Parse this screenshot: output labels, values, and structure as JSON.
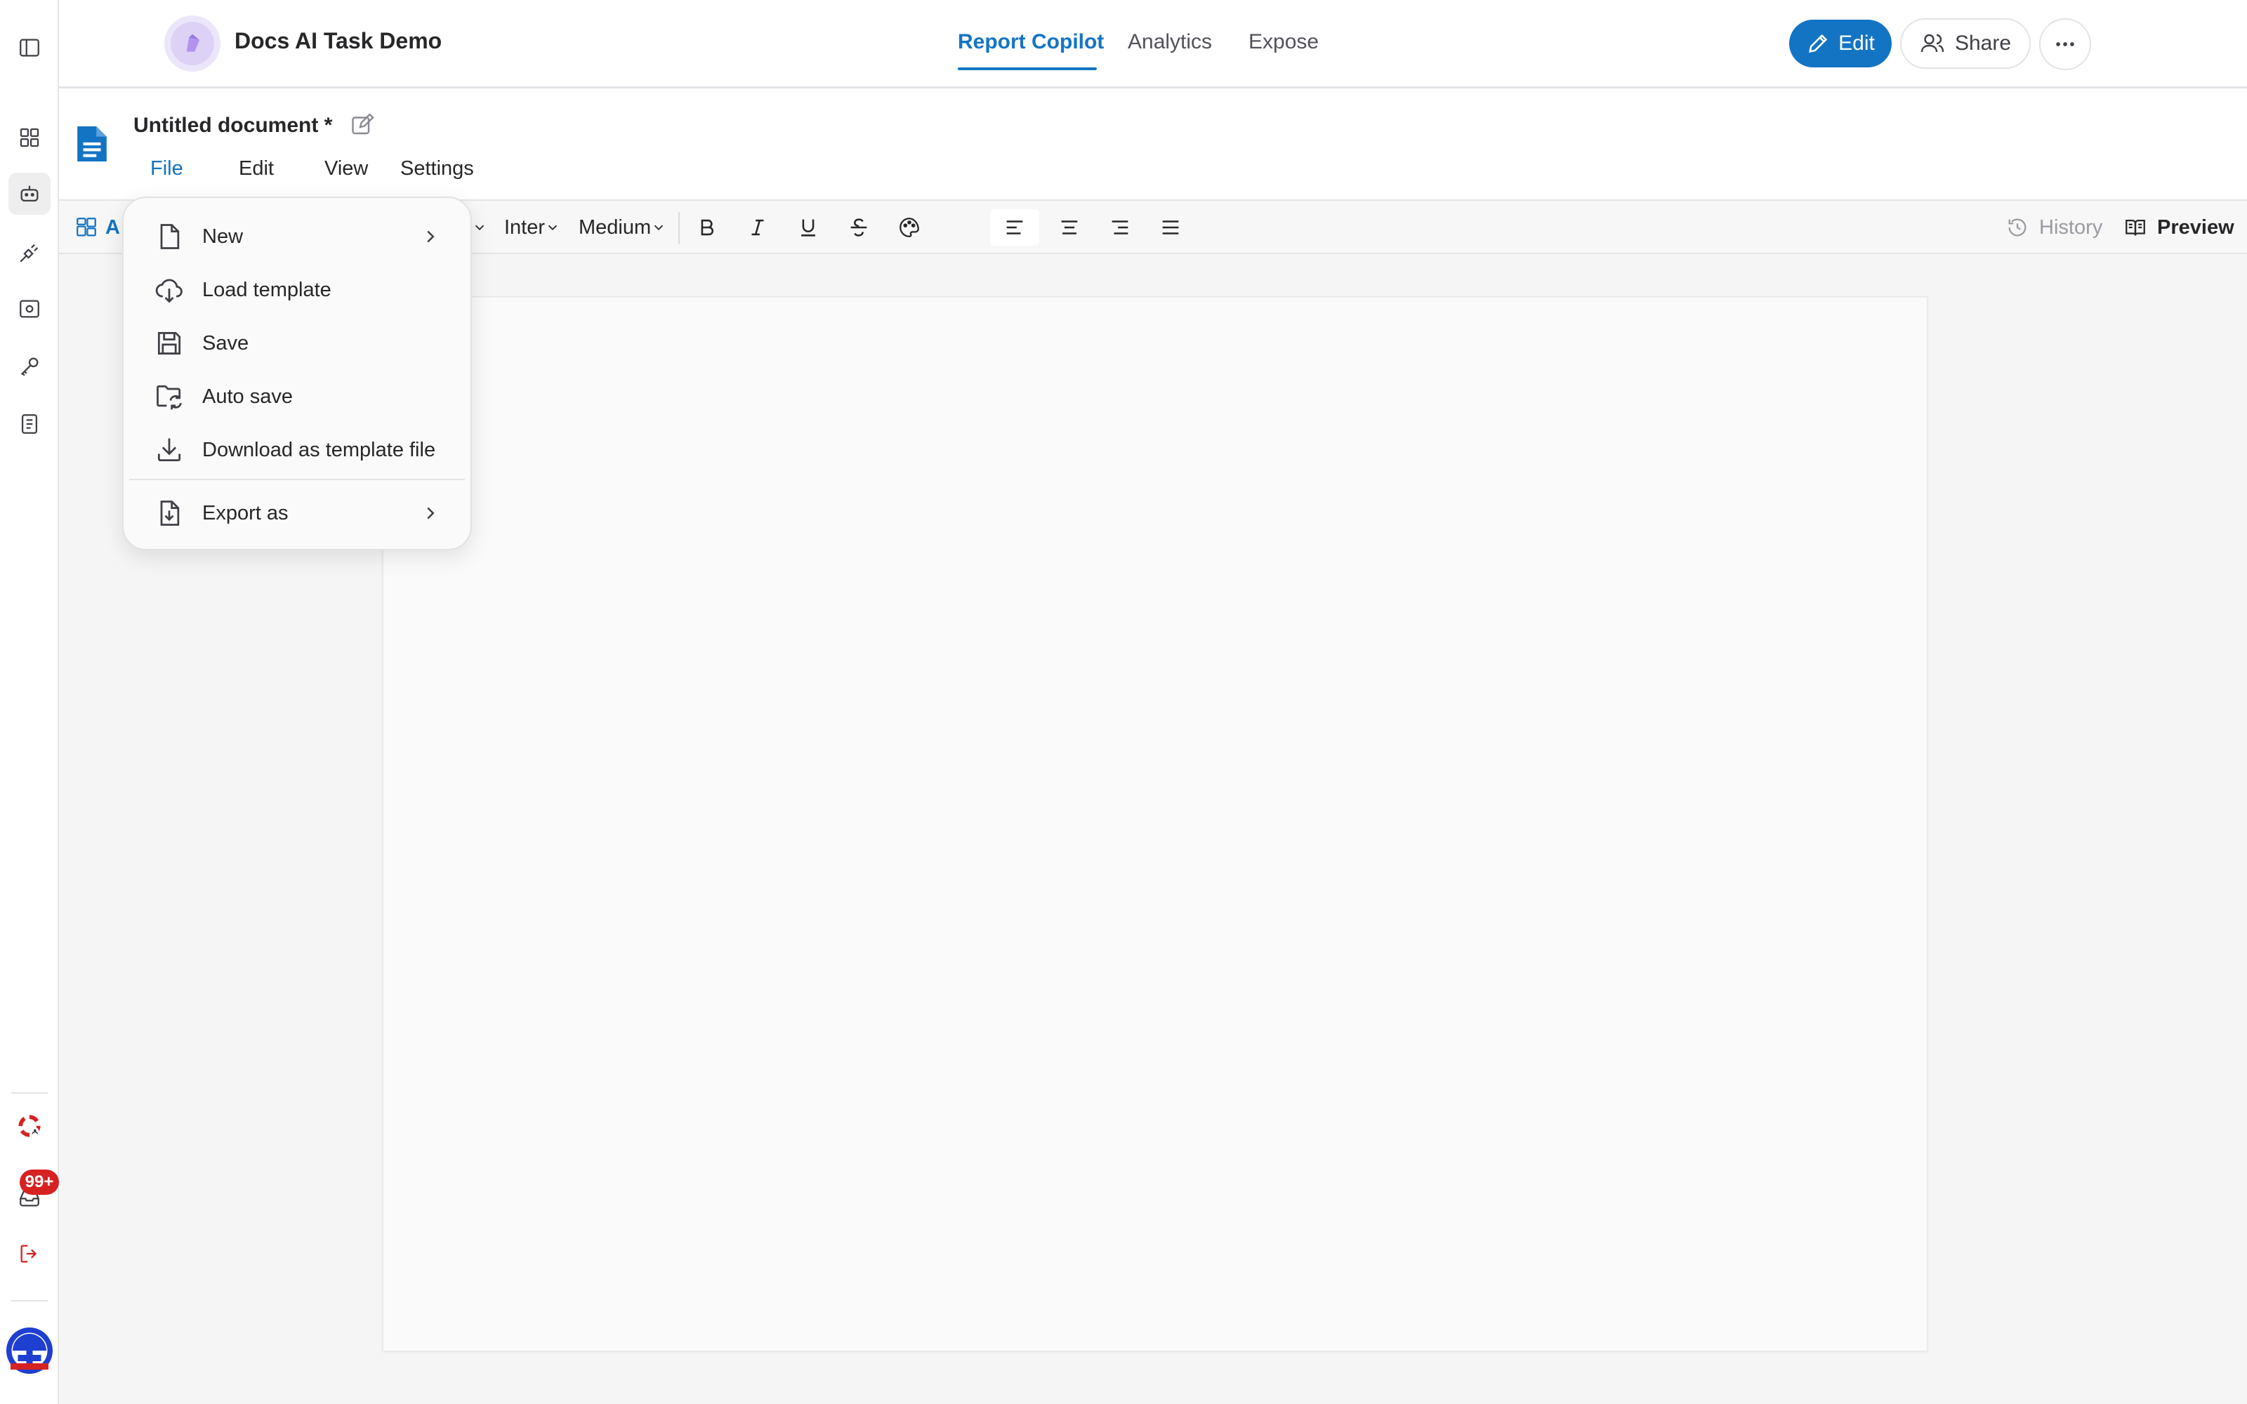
{
  "app": {
    "title": "Docs AI Task Demo",
    "tabs": [
      {
        "label": "Report Copilot",
        "active": true
      },
      {
        "label": "Analytics",
        "active": false
      },
      {
        "label": "Expose",
        "active": false
      }
    ],
    "actions": {
      "edit": "Edit",
      "share": "Share"
    }
  },
  "sidebar": {
    "items": [
      "panel-toggle-icon",
      "dashboard-icon",
      "bot-icon",
      "plug-icon",
      "gear-screen-icon",
      "key-icon",
      "notebook-icon",
      "support-icon",
      "inbox-icon",
      "logout-icon",
      "avatar"
    ],
    "active": "bot-icon",
    "inbox_badge": "99+"
  },
  "document": {
    "title": "Untitled document *",
    "menus": [
      {
        "label": "File",
        "active": true
      },
      {
        "label": "Edit",
        "active": false
      },
      {
        "label": "View",
        "active": false
      },
      {
        "label": "Settings",
        "active": false
      }
    ]
  },
  "toolbar": {
    "partial_label": "A",
    "font_family": "Inter",
    "font_weight": "Medium",
    "history": "History",
    "preview": "Preview"
  },
  "file_menu": {
    "items": [
      {
        "label": "New",
        "icon": "file-icon",
        "submenu": true
      },
      {
        "label": "Load template",
        "icon": "cloud-download-icon",
        "submenu": false
      },
      {
        "label": "Save",
        "icon": "save-icon",
        "submenu": false
      },
      {
        "label": "Auto save",
        "icon": "folder-sync-icon",
        "submenu": false
      },
      {
        "label": "Download as template file",
        "icon": "download-icon",
        "submenu": false
      },
      {
        "label": "Export as",
        "icon": "file-export-icon",
        "submenu": true
      }
    ]
  },
  "colors": {
    "accent": "#1474c4",
    "badge": "#d62222",
    "logo": "#b294ee"
  }
}
